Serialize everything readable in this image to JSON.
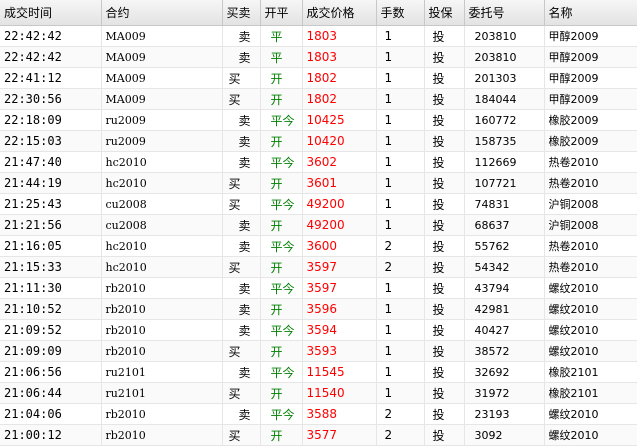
{
  "columns": [
    "成交时间",
    "合约",
    "买卖",
    "开平",
    "成交价格",
    "手数",
    "投保",
    "委托号",
    "名称"
  ],
  "rows": [
    {
      "time": "22:42:42",
      "contract": "MA009",
      "side": "卖",
      "oc": "平",
      "price": "1803",
      "qty": "1",
      "hedge": "投",
      "order": "203810",
      "name": "甲醇2009"
    },
    {
      "time": "22:42:42",
      "contract": "MA009",
      "side": "卖",
      "oc": "平",
      "price": "1803",
      "qty": "1",
      "hedge": "投",
      "order": "203810",
      "name": "甲醇2009"
    },
    {
      "time": "22:41:12",
      "contract": "MA009",
      "side": "买",
      "oc": "开",
      "price": "1802",
      "qty": "1",
      "hedge": "投",
      "order": "201303",
      "name": "甲醇2009"
    },
    {
      "time": "22:30:56",
      "contract": "MA009",
      "side": "买",
      "oc": "开",
      "price": "1802",
      "qty": "1",
      "hedge": "投",
      "order": "184044",
      "name": "甲醇2009"
    },
    {
      "time": "22:18:09",
      "contract": "ru2009",
      "side": "卖",
      "oc": "平今",
      "price": "10425",
      "qty": "1",
      "hedge": "投",
      "order": "160772",
      "name": "橡胶2009"
    },
    {
      "time": "22:15:03",
      "contract": "ru2009",
      "side": "卖",
      "oc": "开",
      "price": "10420",
      "qty": "1",
      "hedge": "投",
      "order": "158735",
      "name": "橡胶2009"
    },
    {
      "time": "21:47:40",
      "contract": "hc2010",
      "side": "卖",
      "oc": "平今",
      "price": "3602",
      "qty": "1",
      "hedge": "投",
      "order": "112669",
      "name": "热卷2010"
    },
    {
      "time": "21:44:19",
      "contract": "hc2010",
      "side": "买",
      "oc": "开",
      "price": "3601",
      "qty": "1",
      "hedge": "投",
      "order": "107721",
      "name": "热卷2010"
    },
    {
      "time": "21:25:43",
      "contract": "cu2008",
      "side": "买",
      "oc": "平今",
      "price": "49200",
      "qty": "1",
      "hedge": "投",
      "order": "74831",
      "name": "沪铜2008"
    },
    {
      "time": "21:21:56",
      "contract": "cu2008",
      "side": "卖",
      "oc": "开",
      "price": "49200",
      "qty": "1",
      "hedge": "投",
      "order": "68637",
      "name": "沪铜2008"
    },
    {
      "time": "21:16:05",
      "contract": "hc2010",
      "side": "卖",
      "oc": "平今",
      "price": "3600",
      "qty": "2",
      "hedge": "投",
      "order": "55762",
      "name": "热卷2010"
    },
    {
      "time": "21:15:33",
      "contract": "hc2010",
      "side": "买",
      "oc": "开",
      "price": "3597",
      "qty": "2",
      "hedge": "投",
      "order": "54342",
      "name": "热卷2010"
    },
    {
      "time": "21:11:30",
      "contract": "rb2010",
      "side": "卖",
      "oc": "平今",
      "price": "3597",
      "qty": "1",
      "hedge": "投",
      "order": "43794",
      "name": "螺纹2010"
    },
    {
      "time": "21:10:52",
      "contract": "rb2010",
      "side": "卖",
      "oc": "开",
      "price": "3596",
      "qty": "1",
      "hedge": "投",
      "order": "42981",
      "name": "螺纹2010"
    },
    {
      "time": "21:09:52",
      "contract": "rb2010",
      "side": "卖",
      "oc": "平今",
      "price": "3594",
      "qty": "1",
      "hedge": "投",
      "order": "40427",
      "name": "螺纹2010"
    },
    {
      "time": "21:09:09",
      "contract": "rb2010",
      "side": "买",
      "oc": "开",
      "price": "3593",
      "qty": "1",
      "hedge": "投",
      "order": "38572",
      "name": "螺纹2010"
    },
    {
      "time": "21:06:56",
      "contract": "ru2101",
      "side": "卖",
      "oc": "平今",
      "price": "11545",
      "qty": "1",
      "hedge": "投",
      "order": "32692",
      "name": "橡胶2101"
    },
    {
      "time": "21:06:44",
      "contract": "ru2101",
      "side": "买",
      "oc": "开",
      "price": "11540",
      "qty": "1",
      "hedge": "投",
      "order": "31972",
      "name": "橡胶2101"
    },
    {
      "time": "21:04:06",
      "contract": "rb2010",
      "side": "卖",
      "oc": "平今",
      "price": "3588",
      "qty": "2",
      "hedge": "投",
      "order": "23193",
      "name": "螺纹2010"
    },
    {
      "time": "21:00:12",
      "contract": "rb2010",
      "side": "买",
      "oc": "开",
      "price": "3577",
      "qty": "2",
      "hedge": "投",
      "order": "3092",
      "name": "螺纹2010"
    }
  ]
}
